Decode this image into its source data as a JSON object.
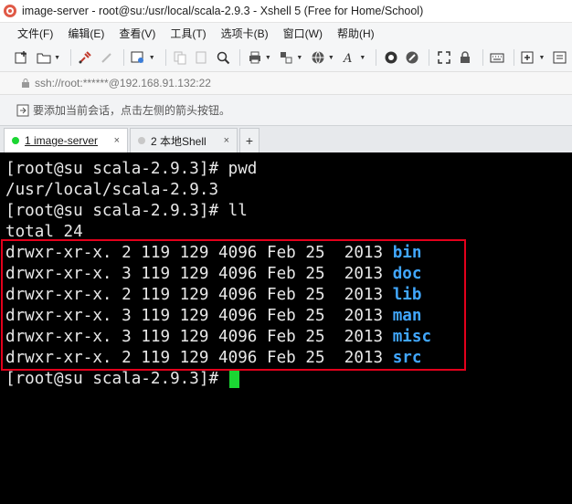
{
  "window": {
    "title": "image-server - root@su:/usr/local/scala-2.9.3 - Xshell 5 (Free for Home/School)"
  },
  "menu": [
    "文件(F)",
    "编辑(E)",
    "查看(V)",
    "工具(T)",
    "选项卡(B)",
    "窗口(W)",
    "帮助(H)"
  ],
  "address": {
    "text": "ssh://root:******@192.168.91.132:22"
  },
  "hint": {
    "text": "要添加当前会话，点击左侧的箭头按钮。"
  },
  "tabs": [
    {
      "label": "1 image-server",
      "status_color": "#1bd633",
      "close": "×"
    },
    {
      "label": "2 本地Shell",
      "status_color": "#c8c8c8",
      "close": "×"
    }
  ],
  "tab_add": "+",
  "terminal": {
    "lines": [
      "[root@su scala-2.9.3]# pwd",
      "/usr/local/scala-2.9.3",
      "[root@su scala-2.9.3]# ll",
      "total 24"
    ],
    "listing": [
      {
        "perms": "drwxr-xr-x. 2 119 129 4096 Feb 25  2013 ",
        "name": "bin"
      },
      {
        "perms": "drwxr-xr-x. 3 119 129 4096 Feb 25  2013 ",
        "name": "doc"
      },
      {
        "perms": "drwxr-xr-x. 2 119 129 4096 Feb 25  2013 ",
        "name": "lib"
      },
      {
        "perms": "drwxr-xr-x. 3 119 129 4096 Feb 25  2013 ",
        "name": "man"
      },
      {
        "perms": "drwxr-xr-x. 3 119 129 4096 Feb 25  2013 ",
        "name": "misc"
      },
      {
        "perms": "drwxr-xr-x. 2 119 129 4096 Feb 25  2013 ",
        "name": "src"
      }
    ],
    "prompt": "[root@su scala-2.9.3]# "
  },
  "colors": {
    "directory": "#41a7ff",
    "cursor": "#1bd633",
    "highlight": "#e3001b"
  }
}
